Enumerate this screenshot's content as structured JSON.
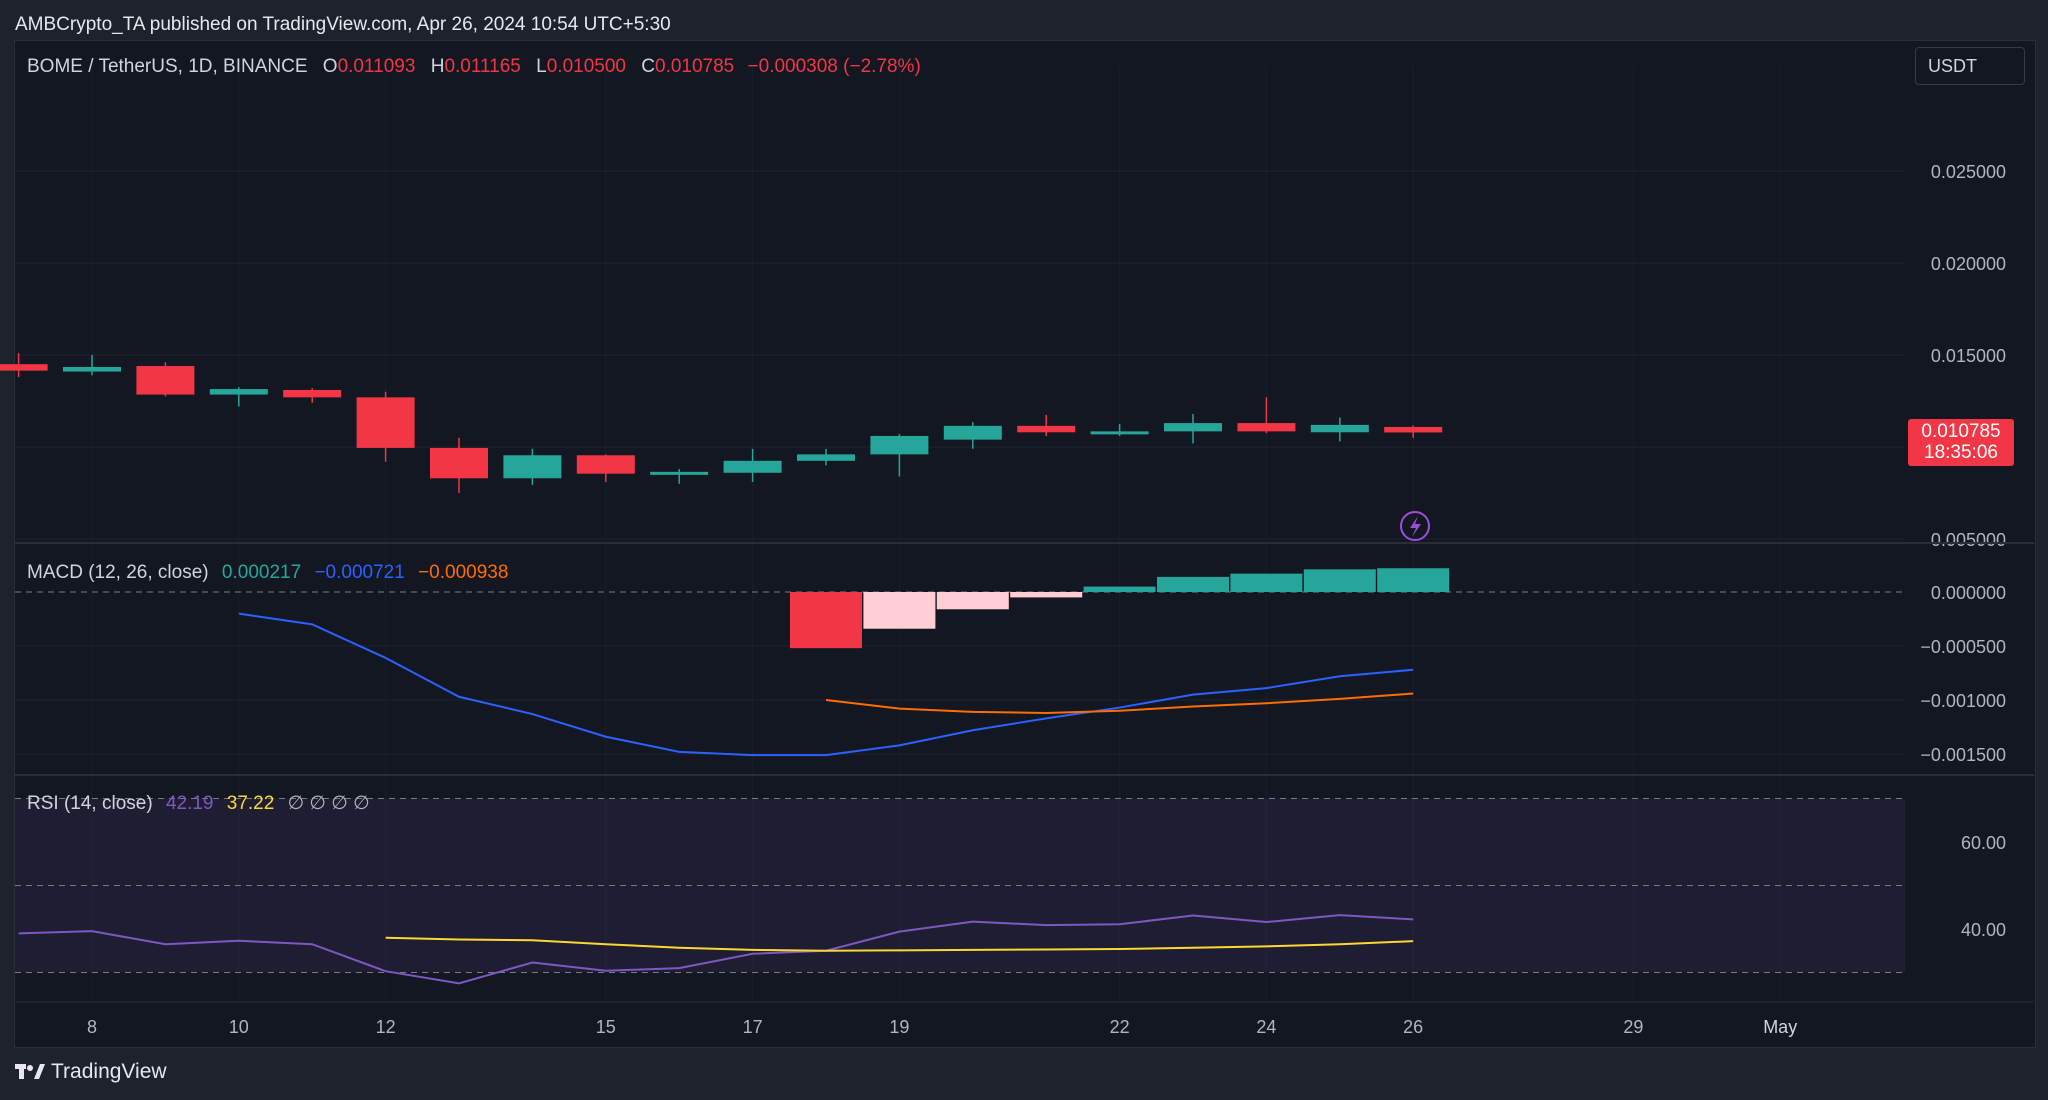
{
  "publisher_line": "AMBCrypto_TA published on TradingView.com, Apr 26, 2024 10:54 UTC+5:30",
  "brand": "TradingView",
  "currency_button": "USDT",
  "symbol": {
    "name": "BOME / TetherUS, 1D, BINANCE",
    "open_label": "O",
    "open": "0.011093",
    "high_label": "H",
    "high": "0.011165",
    "low_label": "L",
    "low": "0.010500",
    "close_label": "C",
    "close": "0.010785",
    "change": "−0.000308 (−2.78%)"
  },
  "price_tag": {
    "price": "0.010785",
    "countdown": "18:35:06"
  },
  "macd": {
    "title": "MACD (12, 26, close)",
    "histogram": "0.000217",
    "macd": "−0.000721",
    "signal": "−0.000938"
  },
  "rsi": {
    "title": "RSI (14, close)",
    "rsi": "42.19",
    "ma": "37.22",
    "extra": "∅ ∅ ∅ ∅"
  },
  "colors": {
    "up": "#26a69a",
    "down": "#f23645",
    "macd_line": "#2962ff",
    "signal_line": "#ff6d00",
    "rsi_line": "#7e57c2",
    "rsi_ma": "#fdd835",
    "hist_light_down": "#ffcdd2"
  },
  "chart_data": [
    {
      "type": "candlestick",
      "title": "BOME / TetherUS, 1D, BINANCE",
      "x_ticks": [
        "8",
        "10",
        "12",
        "15",
        "17",
        "19",
        "22",
        "24",
        "26",
        "29",
        "May"
      ],
      "y_ticks": [
        "0.025000",
        "0.020000",
        "0.015000",
        "0.005000"
      ],
      "ylim": [
        0.0045,
        0.0283
      ],
      "candles": [
        {
          "date": "2024-04-07",
          "o": 0.0145,
          "h": 0.0151,
          "l": 0.0138,
          "c": 0.01415
        },
        {
          "date": "2024-04-08",
          "o": 0.0141,
          "h": 0.015,
          "l": 0.0139,
          "c": 0.01435
        },
        {
          "date": "2024-04-09",
          "o": 0.0144,
          "h": 0.0146,
          "l": 0.01275,
          "c": 0.01285
        },
        {
          "date": "2024-04-10",
          "o": 0.01285,
          "h": 0.01325,
          "l": 0.0122,
          "c": 0.01315
        },
        {
          "date": "2024-04-11",
          "o": 0.0131,
          "h": 0.0132,
          "l": 0.0124,
          "c": 0.0127
        },
        {
          "date": "2024-04-12",
          "o": 0.0127,
          "h": 0.013,
          "l": 0.0092,
          "c": 0.00995
        },
        {
          "date": "2024-04-13",
          "o": 0.00995,
          "h": 0.0105,
          "l": 0.0075,
          "c": 0.0083
        },
        {
          "date": "2024-04-14",
          "o": 0.0083,
          "h": 0.0099,
          "l": 0.00795,
          "c": 0.00955
        },
        {
          "date": "2024-04-15",
          "o": 0.00955,
          "h": 0.0096,
          "l": 0.0081,
          "c": 0.00855
        },
        {
          "date": "2024-04-16",
          "o": 0.00855,
          "h": 0.0088,
          "l": 0.008,
          "c": 0.00865
        },
        {
          "date": "2024-04-17",
          "o": 0.0086,
          "h": 0.0099,
          "l": 0.0081,
          "c": 0.00925
        },
        {
          "date": "2024-04-18",
          "o": 0.00925,
          "h": 0.0099,
          "l": 0.009,
          "c": 0.0096
        },
        {
          "date": "2024-04-19",
          "o": 0.0096,
          "h": 0.0107,
          "l": 0.0084,
          "c": 0.0106
        },
        {
          "date": "2024-04-20",
          "o": 0.0104,
          "h": 0.01135,
          "l": 0.0099,
          "c": 0.01115
        },
        {
          "date": "2024-04-21",
          "o": 0.01115,
          "h": 0.01175,
          "l": 0.0106,
          "c": 0.0108
        },
        {
          "date": "2024-04-22",
          "o": 0.01075,
          "h": 0.01125,
          "l": 0.0106,
          "c": 0.01085
        },
        {
          "date": "2024-04-23",
          "o": 0.01085,
          "h": 0.0118,
          "l": 0.0102,
          "c": 0.0113
        },
        {
          "date": "2024-04-24",
          "o": 0.0113,
          "h": 0.0127,
          "l": 0.01075,
          "c": 0.01085
        },
        {
          "date": "2024-04-25",
          "o": 0.0108,
          "h": 0.0116,
          "l": 0.0103,
          "c": 0.0112
        },
        {
          "date": "2024-04-26",
          "o": 0.01109,
          "h": 0.01117,
          "l": 0.0105,
          "c": 0.01079
        }
      ]
    },
    {
      "type": "bar-line",
      "title": "MACD (12, 26, close)",
      "y_ticks": [
        "0.000000",
        "−0.000500",
        "−0.001000",
        "−0.001500"
      ],
      "ylim": [
        -0.00165,
        0.00033
      ],
      "series": [
        {
          "name": "MACD",
          "type": "line",
          "points": [
            [
              "2024-04-10",
              -0.0002
            ],
            [
              "2024-04-11",
              -0.0003
            ],
            [
              "2024-04-12",
              -0.00061
            ],
            [
              "2024-04-13",
              -0.00097
            ],
            [
              "2024-04-14",
              -0.00113
            ],
            [
              "2024-04-15",
              -0.00134
            ],
            [
              "2024-04-16",
              -0.00148
            ],
            [
              "2024-04-17",
              -0.00151
            ],
            [
              "2024-04-18",
              -0.00151
            ],
            [
              "2024-04-19",
              -0.00142
            ],
            [
              "2024-04-20",
              -0.00128
            ],
            [
              "2024-04-21",
              -0.00117
            ],
            [
              "2024-04-22",
              -0.00107
            ],
            [
              "2024-04-23",
              -0.00095
            ],
            [
              "2024-04-24",
              -0.00089
            ],
            [
              "2024-04-25",
              -0.00078
            ],
            [
              "2024-04-26",
              -0.00072
            ]
          ]
        },
        {
          "name": "Signal",
          "type": "line",
          "points": [
            [
              "2024-04-18",
              -0.001
            ],
            [
              "2024-04-19",
              -0.00108
            ],
            [
              "2024-04-20",
              -0.00111
            ],
            [
              "2024-04-21",
              -0.00112
            ],
            [
              "2024-04-22",
              -0.0011
            ],
            [
              "2024-04-23",
              -0.00106
            ],
            [
              "2024-04-24",
              -0.00103
            ],
            [
              "2024-04-25",
              -0.00099
            ],
            [
              "2024-04-26",
              -0.00094
            ]
          ]
        },
        {
          "name": "Histogram",
          "type": "bar",
          "points": [
            [
              "2024-04-18",
              -0.00052
            ],
            [
              "2024-04-19",
              -0.00034
            ],
            [
              "2024-04-20",
              -0.00016
            ],
            [
              "2024-04-21",
              -5e-05
            ],
            [
              "2024-04-22",
              5e-05
            ],
            [
              "2024-04-23",
              0.00014
            ],
            [
              "2024-04-24",
              0.00017
            ],
            [
              "2024-04-25",
              0.00021
            ],
            [
              "2024-04-26",
              0.00022
            ]
          ]
        }
      ]
    },
    {
      "type": "line",
      "title": "RSI (14, close)",
      "y_ticks": [
        "60.00",
        "40.00"
      ],
      "ylim": [
        27,
        73
      ],
      "bands": {
        "upper": 70,
        "middle": 50,
        "lower": 30
      },
      "series": [
        {
          "name": "RSI",
          "points": [
            [
              "2024-04-07",
              39.0
            ],
            [
              "2024-04-08",
              39.5
            ],
            [
              "2024-04-09",
              36.5
            ],
            [
              "2024-04-10",
              37.3
            ],
            [
              "2024-04-11",
              36.5
            ],
            [
              "2024-04-12",
              30.3
            ],
            [
              "2024-04-13",
              27.5
            ],
            [
              "2024-04-14",
              32.3
            ],
            [
              "2024-04-15",
              30.4
            ],
            [
              "2024-04-16",
              31.0
            ],
            [
              "2024-04-17",
              34.3
            ],
            [
              "2024-04-18",
              35.0
            ],
            [
              "2024-04-19",
              39.4
            ],
            [
              "2024-04-20",
              41.7
            ],
            [
              "2024-04-21",
              40.9
            ],
            [
              "2024-04-22",
              41.1
            ],
            [
              "2024-04-23",
              43.1
            ],
            [
              "2024-04-24",
              41.6
            ],
            [
              "2024-04-25",
              43.2
            ],
            [
              "2024-04-26",
              42.2
            ]
          ]
        },
        {
          "name": "RSI-based MA",
          "points": [
            [
              "2024-04-12",
              38.0
            ],
            [
              "2024-04-13",
              37.6
            ],
            [
              "2024-04-14",
              37.4
            ],
            [
              "2024-04-15",
              36.5
            ],
            [
              "2024-04-16",
              35.7
            ],
            [
              "2024-04-17",
              35.2
            ],
            [
              "2024-04-18",
              35.0
            ],
            [
              "2024-04-19",
              35.1
            ],
            [
              "2024-04-20",
              35.2
            ],
            [
              "2024-04-21",
              35.3
            ],
            [
              "2024-04-22",
              35.4
            ],
            [
              "2024-04-23",
              35.7
            ],
            [
              "2024-04-24",
              36.0
            ],
            [
              "2024-04-25",
              36.5
            ],
            [
              "2024-04-26",
              37.2
            ]
          ]
        }
      ]
    }
  ]
}
